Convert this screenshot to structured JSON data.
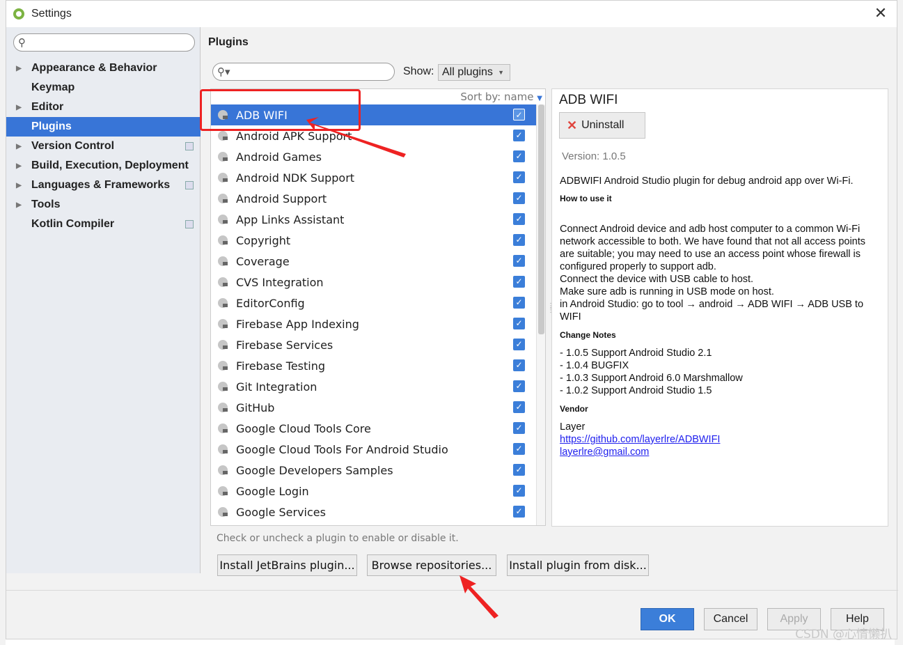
{
  "window": {
    "title": "Settings"
  },
  "sidebar": {
    "search_placeholder": "",
    "items": [
      {
        "label": "Appearance & Behavior",
        "expandable": true,
        "project_icon": false
      },
      {
        "label": "Keymap",
        "expandable": false,
        "project_icon": false
      },
      {
        "label": "Editor",
        "expandable": true,
        "project_icon": false
      },
      {
        "label": "Plugins",
        "expandable": false,
        "project_icon": false,
        "selected": true
      },
      {
        "label": "Version Control",
        "expandable": true,
        "project_icon": true
      },
      {
        "label": "Build, Execution, Deployment",
        "expandable": true,
        "project_icon": false
      },
      {
        "label": "Languages & Frameworks",
        "expandable": true,
        "project_icon": true
      },
      {
        "label": "Tools",
        "expandable": true,
        "project_icon": false
      },
      {
        "label": "Kotlin Compiler",
        "expandable": false,
        "project_icon": true
      }
    ]
  },
  "main": {
    "title": "Plugins",
    "show_label": "Show:",
    "show_value": "All plugins",
    "sort_label": "Sort by: name",
    "plugins": [
      {
        "name": "ADB WIFI",
        "checked": true,
        "selected": true
      },
      {
        "name": "Android APK Support",
        "checked": true
      },
      {
        "name": "Android Games",
        "checked": true
      },
      {
        "name": "Android NDK Support",
        "checked": true
      },
      {
        "name": "Android Support",
        "checked": true
      },
      {
        "name": "App Links Assistant",
        "checked": true
      },
      {
        "name": "Copyright",
        "checked": true
      },
      {
        "name": "Coverage",
        "checked": true
      },
      {
        "name": "CVS Integration",
        "checked": true
      },
      {
        "name": "EditorConfig",
        "checked": true
      },
      {
        "name": "Firebase App Indexing",
        "checked": true
      },
      {
        "name": "Firebase Services",
        "checked": true
      },
      {
        "name": "Firebase Testing",
        "checked": true
      },
      {
        "name": "Git Integration",
        "checked": true
      },
      {
        "name": "GitHub",
        "checked": true
      },
      {
        "name": "Google Cloud Tools Core",
        "checked": true
      },
      {
        "name": "Google Cloud Tools For Android Studio",
        "checked": true
      },
      {
        "name": "Google Developers Samples",
        "checked": true
      },
      {
        "name": "Google Login",
        "checked": true
      },
      {
        "name": "Google Services",
        "checked": true
      }
    ],
    "hint": "Check or uncheck a plugin to enable or disable it.",
    "buttons": {
      "install_jetbrains": "Install JetBrains plugin...",
      "browse": "Browse repositories...",
      "install_disk": "Install plugin from disk..."
    }
  },
  "detail": {
    "title": "ADB WIFI",
    "uninstall": "Uninstall",
    "version": "Version: 1.0.5",
    "description": "ADBWIFI Android Studio plugin for debug android app over Wi-Fi.",
    "how_to_heading": "How to use it",
    "how_to_lines": [
      "Connect Android device and adb host computer to a common Wi-Fi",
      "network accessible to both. We have found that not all access points",
      "are suitable; you may need to use an access point whose firewall is",
      "configured properly to support adb.",
      "Connect the device with USB cable to host.",
      "Make sure adb is running in USB mode on host.",
      "in Android Studio: go to tool → android → ADB WIFI → ADB USB to",
      "WIFI"
    ],
    "change_notes_heading": "Change Notes",
    "change_notes": [
      "- 1.0.5 Support Android Studio 2.1",
      "- 1.0.4 BUGFIX",
      "- 1.0.3 Support Android 6.0 Marshmallow",
      "- 1.0.2 Support Android Studio 1.5"
    ],
    "vendor_heading": "Vendor",
    "vendor_name": "Layer",
    "vendor_url": "https://github.com/layerlre/ADBWIFI",
    "vendor_email": "layerlre@gmail.com"
  },
  "footer": {
    "ok": "OK",
    "cancel": "Cancel",
    "apply": "Apply",
    "help": "Help"
  },
  "watermark": "CSDN @心情懒扒",
  "colors": {
    "accent": "#3875d7",
    "annotation": "#ee2222"
  }
}
